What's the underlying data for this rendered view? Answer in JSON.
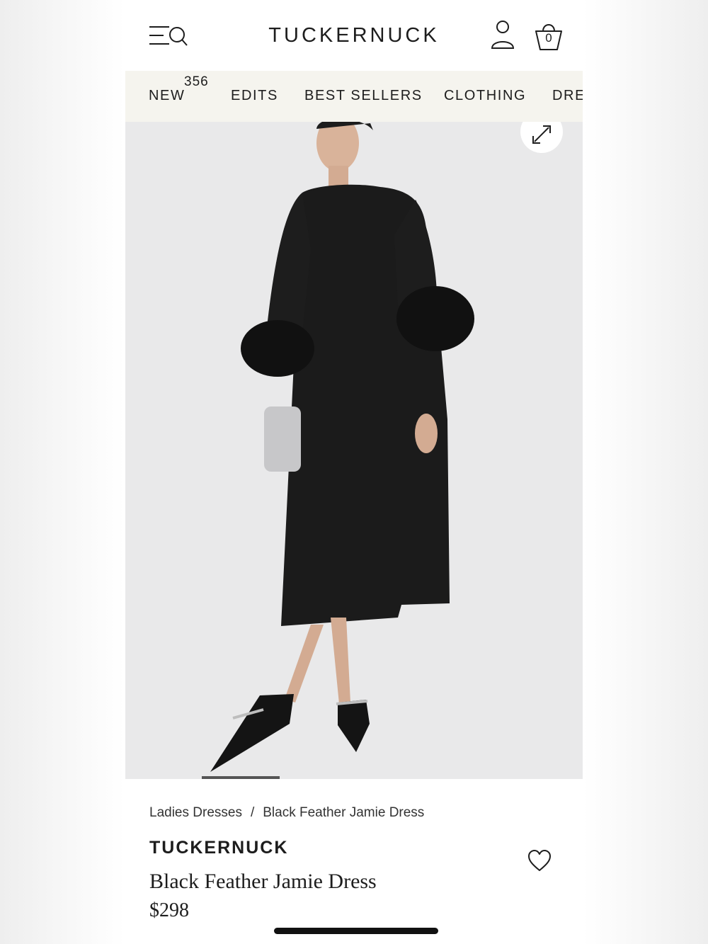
{
  "header": {
    "logo": "TUCKERNUCK",
    "bag_count": "0"
  },
  "nav": {
    "items": [
      {
        "label": "NEW",
        "badge": "356"
      },
      {
        "label": "EDITS"
      },
      {
        "label": "BEST SELLERS"
      },
      {
        "label": "CLOTHING"
      },
      {
        "label": "DRE"
      }
    ]
  },
  "icons": {
    "menu_search": "menu-search-icon",
    "account": "user-icon",
    "bag": "shopping-bag-icon",
    "expand": "expand-icon",
    "wishlist": "heart-icon"
  },
  "breadcrumb": {
    "items": [
      "Ladies Dresses",
      "Black Feather Jamie Dress"
    ],
    "separator": "/"
  },
  "product": {
    "brand": "TUCKERNUCK",
    "name": "Black Feather Jamie Dress",
    "price": "$298"
  },
  "colors": {
    "nav_bg": "#f5f4ee",
    "image_bg": "#e9e9ea",
    "text": "#1d1d1d"
  }
}
